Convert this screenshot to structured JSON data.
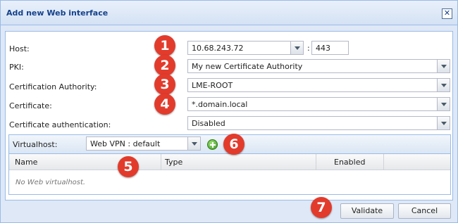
{
  "dialog": {
    "title": "Add new Web interface",
    "close_icon": "close-icon"
  },
  "form": {
    "host_label": "Host:",
    "host_value": "10.68.243.72",
    "port_value": "443",
    "pki_label": "PKI:",
    "pki_value": "My new Certificate Authority",
    "ca_label": "Certification Authority:",
    "ca_value": "LME-ROOT",
    "cert_label": "Certificate:",
    "cert_value": "*.domain.local",
    "certauth_label": "Certificate authentication:",
    "certauth_value": "Disabled"
  },
  "virtualhost": {
    "label": "Virtualhost:",
    "selected": "Web VPN : default",
    "columns": [
      "Name",
      "Type",
      "Enabled"
    ],
    "empty_text": "No Web virtualhost."
  },
  "buttons": {
    "validate": "Validate",
    "cancel": "Cancel"
  },
  "badges": [
    "1",
    "2",
    "3",
    "4",
    "5",
    "6",
    "7"
  ],
  "colors": {
    "accent": "#15428b",
    "badge": "#e23b2c",
    "frame": "#dfe8f6"
  }
}
